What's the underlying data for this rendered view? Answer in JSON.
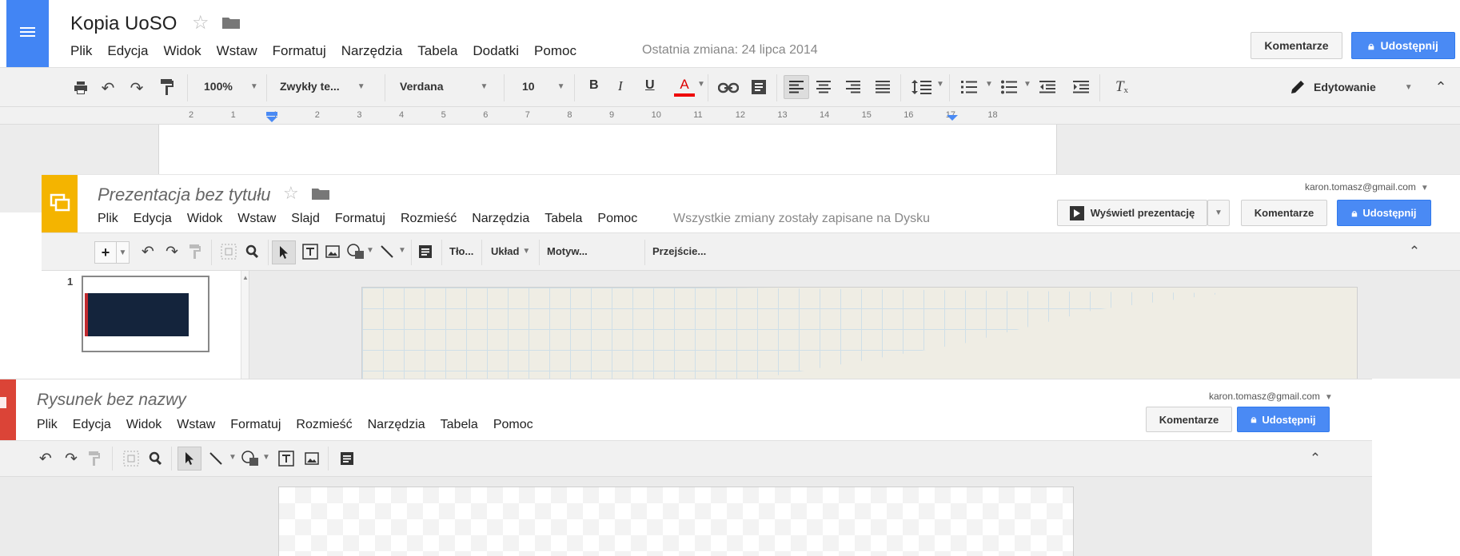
{
  "docs": {
    "title": "Kopia UoSO",
    "menu": [
      "Plik",
      "Edycja",
      "Widok",
      "Wstaw",
      "Formatuj",
      "Narzędzia",
      "Tabela",
      "Dodatki",
      "Pomoc"
    ],
    "last_change": "Ostatnia zmiana: 24 lipca 2014",
    "comments_label": "Komentarze",
    "share_label": "Udostępnij",
    "zoom": "100%",
    "style": "Zwykły te...",
    "font": "Verdana",
    "font_size": "10",
    "bold": "B",
    "italic": "I",
    "underline": "U",
    "text_color": "A",
    "mode": "Edytowanie",
    "ruler": [
      "2",
      "1",
      "1",
      "2",
      "3",
      "4",
      "5",
      "6",
      "7",
      "8",
      "9",
      "10",
      "11",
      "12",
      "13",
      "14",
      "15",
      "16",
      "17",
      "18"
    ],
    "accent": "#4285f4"
  },
  "slides": {
    "title": "Prezentacja bez tytułu",
    "account": "karon.tomasz@gmail.com",
    "menu": [
      "Plik",
      "Edycja",
      "Widok",
      "Wstaw",
      "Slajd",
      "Formatuj",
      "Rozmieść",
      "Narzędzia",
      "Tabela",
      "Pomoc"
    ],
    "saved_status": "Wszystkie zmiany zostały zapisane na Dysku",
    "present_label": "Wyświetl prezentację",
    "comments_label": "Komentarze",
    "share_label": "Udostępnij",
    "bg_label": "Tło...",
    "layout_label": "Układ",
    "theme_label": "Motyw...",
    "transition_label": "Przejście...",
    "slide_number": "1",
    "accent": "#f4b400"
  },
  "drawing": {
    "title": "Rysunek bez nazwy",
    "account": "karon.tomasz@gmail.com",
    "menu": [
      "Plik",
      "Edycja",
      "Widok",
      "Wstaw",
      "Formatuj",
      "Rozmieść",
      "Narzędzia",
      "Tabela",
      "Pomoc"
    ],
    "comments_label": "Komentarze",
    "share_label": "Udostępnij",
    "accent": "#db4437"
  }
}
